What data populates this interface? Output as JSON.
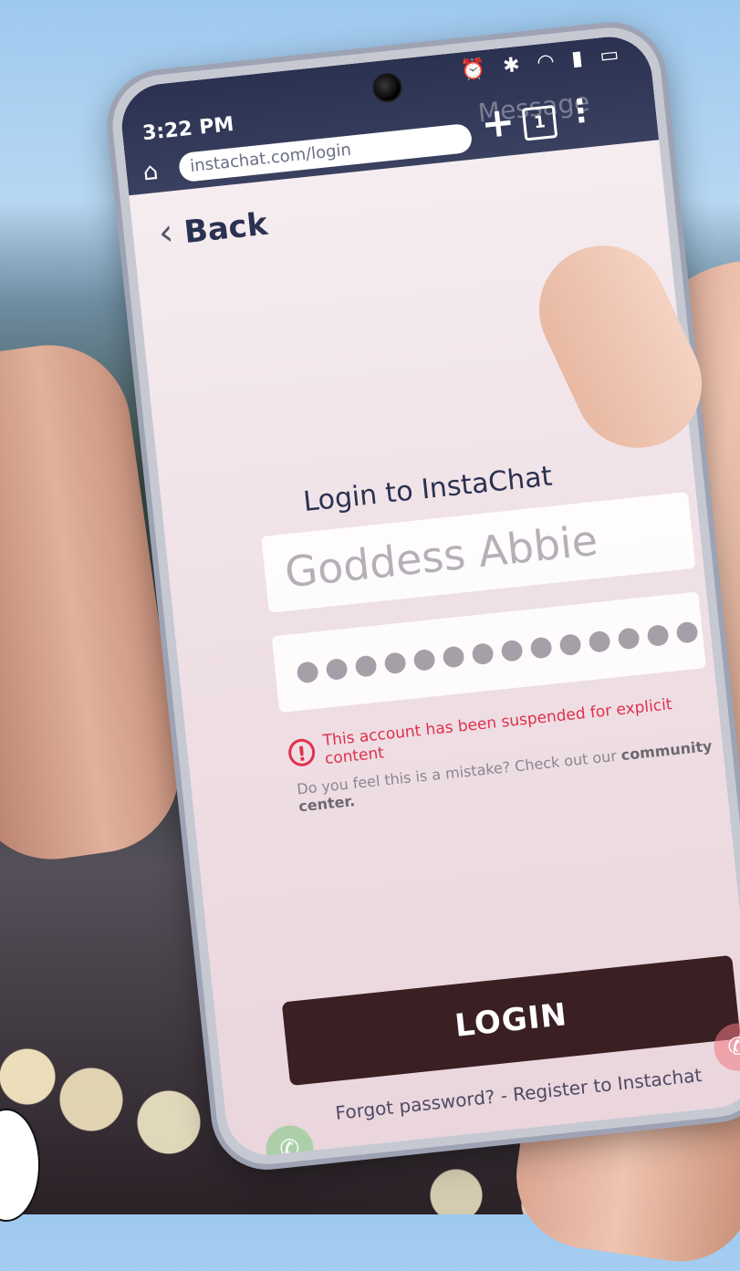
{
  "status_bar": {
    "time": "3:22 PM",
    "icons": [
      "alarm-icon",
      "bluetooth-icon",
      "wifi-icon",
      "signal-icon",
      "battery-icon"
    ]
  },
  "browser": {
    "url": "instachat.com/login",
    "tabs_count": "1",
    "ghost_text": "Message"
  },
  "nav": {
    "back_label": "Back"
  },
  "login": {
    "title": "Login to InstaChat",
    "username_value": "Goddess Abbie",
    "password_value": "●●●●●●●●●●●●●●",
    "error_message": "This account has been suspended for explicit content",
    "help_text": "Do you feel this is a mistake? Check out our",
    "help_link": "community center.",
    "login_button": "LOGIN",
    "footer_link": "Forgot password? - Register to Instachat"
  }
}
